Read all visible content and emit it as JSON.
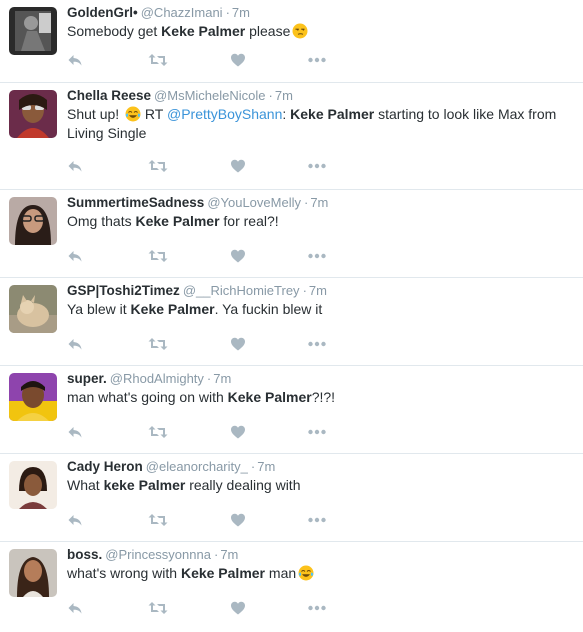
{
  "colors": {
    "name": "#292f33",
    "meta": "#8899a6",
    "link": "#3b94d9",
    "icon": "#aab8c2",
    "divider": "#e1e8ed"
  },
  "actions": {
    "reply_icon": "reply-icon",
    "retweet_icon": "retweet-icon",
    "like_icon": "heart-icon",
    "more_icon": "more-icon"
  },
  "tweets": [
    {
      "name": "GoldenGrl•",
      "handle": "@ChazzImani",
      "sep": "·",
      "time": "7m",
      "text_before": "Somebody get ",
      "highlight": "Keke Palmer",
      "text_after": " please",
      "emoji": "unamused-face"
    },
    {
      "name": "Chella Reese",
      "handle": "@MsMicheleNicole",
      "sep": "·",
      "time": "7m",
      "text_before": "Shut up! ",
      "emoji_inline": "tears-of-joy",
      "rt_prefix": " RT ",
      "mention": "@PrettyBoyShann",
      "mention_after": ": ",
      "highlight": "Keke Palmer",
      "text_after": " starting to look like Max from Living Single"
    },
    {
      "name": "SummertimeSadness",
      "handle": "@YouLoveMelly",
      "sep": "·",
      "time": "7m",
      "text_before": "Omg thats ",
      "highlight": "Keke Palmer",
      "text_after": " for real?!"
    },
    {
      "name": "GSP|Toshi2Timez",
      "handle": "@__RichHomieTrey",
      "sep": "·",
      "time": "7m",
      "text_before": "Ya blew it ",
      "highlight": "Keke Palmer",
      "text_after": ". Ya fuckin blew it"
    },
    {
      "name": "super.",
      "handle": "@RhodAlmighty",
      "sep": "·",
      "time": "7m",
      "text_before": "man what's going on with ",
      "highlight": "Keke Palmer",
      "text_after": "?!?!"
    },
    {
      "name": "Cady Heron",
      "handle": "@eleanorcharity_",
      "sep": "·",
      "time": "7m",
      "text_before": "What ",
      "highlight": "keke Palmer",
      "text_after": " really dealing with"
    },
    {
      "name": "boss.",
      "handle": "@Princessyonnna",
      "sep": "·",
      "time": "7m",
      "text_before": "what's wrong with ",
      "highlight": "Keke Palmer",
      "text_after": " man",
      "emoji": "tears-of-joy"
    }
  ]
}
